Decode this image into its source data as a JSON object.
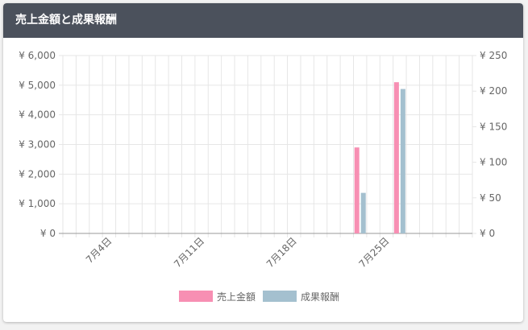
{
  "panel": {
    "title": "売上金額と成果報酬"
  },
  "chart_data": {
    "type": "bar",
    "dates": [
      "2024-07-01",
      "2024-07-02",
      "2024-07-03",
      "2024-07-04",
      "2024-07-05",
      "2024-07-06",
      "2024-07-07",
      "2024-07-08",
      "2024-07-09",
      "2024-07-10",
      "2024-07-11",
      "2024-07-12",
      "2024-07-13",
      "2024-07-14",
      "2024-07-15",
      "2024-07-16",
      "2024-07-17",
      "2024-07-18",
      "2024-07-19",
      "2024-07-20",
      "2024-07-21",
      "2024-07-22",
      "2024-07-23",
      "2024-07-24",
      "2024-07-25",
      "2024-07-26",
      "2024-07-27",
      "2024-07-28",
      "2024-07-29",
      "2024-07-30",
      "2024-07-31"
    ],
    "x_tick_labels": [
      "7月4日",
      "7月11日",
      "7月18日",
      "7月25日"
    ],
    "series": [
      {
        "name": "売上金額",
        "axis": "left",
        "color": "#f78fb3",
        "values": [
          0,
          0,
          0,
          0,
          0,
          0,
          0,
          0,
          0,
          0,
          0,
          0,
          0,
          0,
          0,
          0,
          0,
          0,
          0,
          0,
          0,
          0,
          2900,
          0,
          0,
          5100,
          0,
          0,
          0,
          0,
          0
        ]
      },
      {
        "name": "成果報酬",
        "axis": "right",
        "color": "#a4c0cf",
        "values": [
          0,
          0,
          0,
          0,
          0,
          0,
          0,
          0,
          0,
          0,
          0,
          0,
          0,
          0,
          0,
          0,
          0,
          0,
          0,
          0,
          0,
          0,
          57,
          0,
          0,
          203,
          0,
          0,
          0,
          0,
          0
        ]
      }
    ],
    "y_left": {
      "ticks": [
        "¥ 0",
        "¥ 1,000",
        "¥ 2,000",
        "¥ 3,000",
        "¥ 4,000",
        "¥ 5,000",
        "¥ 6,000"
      ],
      "ylim": [
        0,
        6000
      ]
    },
    "y_right": {
      "ticks": [
        "¥ 0",
        "¥ 50",
        "¥ 100",
        "¥ 150",
        "¥ 200",
        "¥ 250"
      ],
      "ylim": [
        0,
        250
      ]
    },
    "grid": true,
    "legend_position": "bottom-center"
  }
}
